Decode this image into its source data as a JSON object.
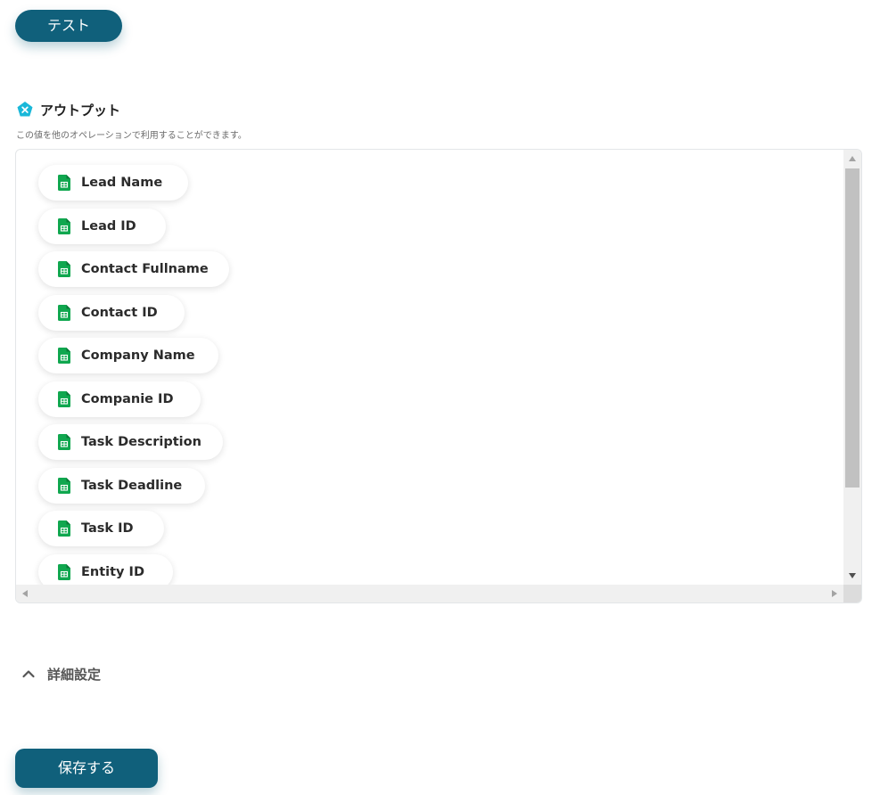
{
  "test_button": {
    "label": "テスト"
  },
  "output": {
    "title": "アウトプット",
    "description": "この値を他のオペレーションで利用することができます。",
    "icon": "output-x-icon",
    "items": [
      {
        "label": "Lead Name",
        "icon": "spreadsheet-icon"
      },
      {
        "label": "Lead ID",
        "icon": "spreadsheet-icon"
      },
      {
        "label": "Contact Fullname",
        "icon": "spreadsheet-icon"
      },
      {
        "label": "Contact ID",
        "icon": "spreadsheet-icon"
      },
      {
        "label": "Company Name",
        "icon": "spreadsheet-icon"
      },
      {
        "label": "Companie ID",
        "icon": "spreadsheet-icon"
      },
      {
        "label": "Task Description",
        "icon": "spreadsheet-icon"
      },
      {
        "label": "Task Deadline",
        "icon": "spreadsheet-icon"
      },
      {
        "label": "Task ID",
        "icon": "spreadsheet-icon"
      },
      {
        "label": "Entity ID",
        "icon": "spreadsheet-icon"
      }
    ]
  },
  "advanced_settings": {
    "label": "詳細設定",
    "icon": "chevron-up-icon"
  },
  "save_button": {
    "label": "保存する"
  },
  "colors": {
    "primary": "#10607b",
    "output_icon": "#1ab8d9",
    "sheet_green": "#10a74f"
  }
}
